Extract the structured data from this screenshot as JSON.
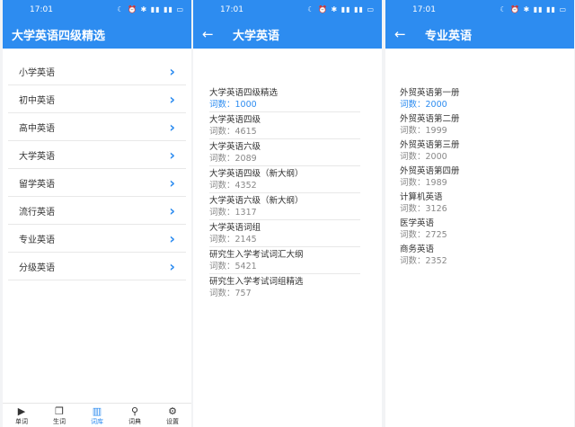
{
  "status": {
    "time": "17:01",
    "icons": "☾ ⏰ ✱ ▮▮ ▮▮ ▭"
  },
  "screen1": {
    "title": "大学英语四级精选",
    "items": [
      "小学英语",
      "初中英语",
      "高中英语",
      "大学英语",
      "留学英语",
      "流行英语",
      "专业英语",
      "分级英语"
    ],
    "chevron": "›"
  },
  "tabs": [
    {
      "icon": "▶",
      "label": "单词",
      "name": "play-icon"
    },
    {
      "icon": "❐",
      "label": "生词",
      "name": "copy-icon"
    },
    {
      "icon": "▥",
      "label": "词库",
      "name": "book-icon"
    },
    {
      "icon": "⚲",
      "label": "词典",
      "name": "search-icon"
    },
    {
      "icon": "⚙",
      "label": "设置",
      "name": "gear-icon"
    }
  ],
  "screen2": {
    "back": "←",
    "title": "大学英语",
    "rows": [
      {
        "name": "大学英语四级精选",
        "count": "词数：1000"
      },
      {
        "name": "大学英语四级",
        "count": "词数：4615"
      },
      {
        "name": "大学英语六级",
        "count": "词数：2089"
      },
      {
        "name": "大学英语四级（新大纲）",
        "count": "词数：4352"
      },
      {
        "name": "大学英语六级（新大纲）",
        "count": "词数：1317"
      },
      {
        "name": "大学英语词组",
        "count": "词数：2145"
      },
      {
        "name": "研究生入学考试词汇大纲",
        "count": "词数：5421"
      },
      {
        "name": "研究生入学考试词组精选",
        "count": "词数：757"
      }
    ]
  },
  "screen3": {
    "back": "←",
    "title": "专业英语",
    "rows": [
      {
        "name": "外贸英语第一册",
        "count": "词数：2000"
      },
      {
        "name": "外贸英语第二册",
        "count": "词数：1999"
      },
      {
        "name": "外贸英语第三册",
        "count": "词数：2000"
      },
      {
        "name": "外贸英语第四册",
        "count": "词数：1989"
      },
      {
        "name": "计算机英语",
        "count": "词数：3126"
      },
      {
        "name": "医学英语",
        "count": "词数：2725"
      },
      {
        "name": "商务英语",
        "count": "词数：2352"
      }
    ]
  }
}
